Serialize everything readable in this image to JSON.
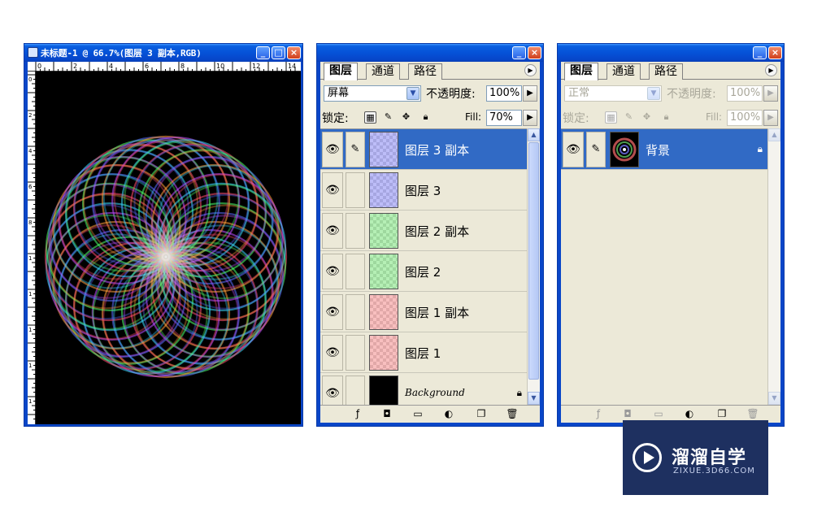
{
  "document": {
    "title": "未标题-1 @ 66.7%(图层 3 副本,RGB)",
    "ruler_top_labels": [
      "0",
      "2",
      "4",
      "6",
      "8",
      "10",
      "12",
      "14"
    ],
    "ruler_left_labels": [
      "0",
      "2",
      "4",
      "6",
      "8",
      "10",
      "12",
      "14",
      "16",
      "18",
      "20"
    ]
  },
  "panel_left": {
    "tabs": [
      "图层",
      "通道",
      "路径"
    ],
    "blend_mode": "屏幕",
    "opacity_label": "不透明度:",
    "opacity_value": "100%",
    "lock_label": "锁定:",
    "fill_label": "Fill:",
    "fill_value": "70%",
    "layers": [
      {
        "name": "图层 3 副本",
        "selected": true,
        "tint": "#6c6cf0"
      },
      {
        "name": "图层 3",
        "selected": false,
        "tint": "#6c6cf0"
      },
      {
        "name": "图层 2 副本",
        "selected": false,
        "tint": "#5cdc5c"
      },
      {
        "name": "图层 2",
        "selected": false,
        "tint": "#5cdc5c"
      },
      {
        "name": "图层 1 副本",
        "selected": false,
        "tint": "#f07070"
      },
      {
        "name": "图层 1",
        "selected": false,
        "tint": "#f07070"
      },
      {
        "name": "Background",
        "selected": false,
        "tint": "#000000"
      }
    ]
  },
  "panel_right": {
    "tabs": [
      "图层",
      "通道",
      "路径"
    ],
    "blend_mode": "正常",
    "opacity_label": "不透明度:",
    "opacity_value": "100%",
    "lock_label": "锁定:",
    "fill_label": "Fill:",
    "fill_value": "100%",
    "layers": [
      {
        "name": "背景",
        "selected": true
      }
    ]
  },
  "watermark": {
    "title": "溜溜自学",
    "subtitle": "ZIXUE.3D66.COM"
  },
  "colors": {
    "selected_row": "#316ac5",
    "window_blue": "#0a46c8",
    "panel_bg": "#ece9d8"
  }
}
